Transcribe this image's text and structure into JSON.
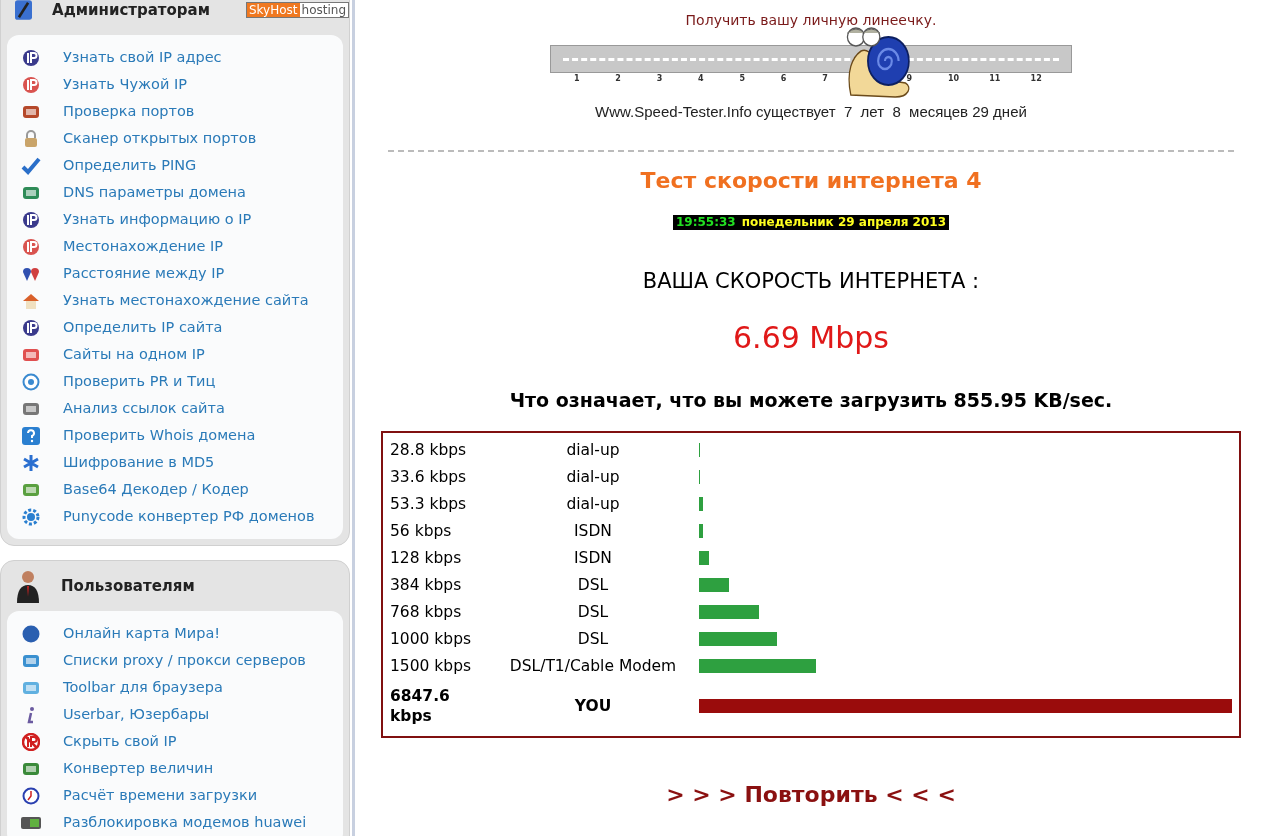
{
  "sidebar": {
    "sections": [
      {
        "title": "Администраторам",
        "badge": {
          "left": "SkyHost",
          "right": "hosting"
        },
        "items": [
          {
            "label": "Узнать свой IP адрес",
            "kind": "ip"
          },
          {
            "label": "Узнать Чужой IP",
            "kind": "ipred"
          },
          {
            "label": "Проверка портов",
            "kind": "firewall"
          },
          {
            "label": "Сканер открытых портов",
            "kind": "lock"
          },
          {
            "label": "Определить PING",
            "kind": "check"
          },
          {
            "label": "DNS параметры домена",
            "kind": "server"
          },
          {
            "label": "Узнать информацию о IP",
            "kind": "ip"
          },
          {
            "label": "Местонахождение IP",
            "kind": "ipred"
          },
          {
            "label": "Расстояние между IP",
            "kind": "pins"
          },
          {
            "label": "Узнать местонахождение сайта",
            "kind": "house"
          },
          {
            "label": "Определить IP сайта",
            "kind": "ip"
          },
          {
            "label": "Сайты на одном IP",
            "kind": "dots"
          },
          {
            "label": "Проверить PR и Тиц",
            "kind": "target"
          },
          {
            "label": "Анализ ссылок сайта",
            "kind": "network"
          },
          {
            "label": "Проверить Whois домена",
            "kind": "question"
          },
          {
            "label": "Шифрование в MD5",
            "kind": "star"
          },
          {
            "label": "Base64 Декодер / Кодер",
            "kind": "download"
          },
          {
            "label": "Punycode конвертер РФ доменов",
            "kind": "gear"
          }
        ]
      },
      {
        "title": "Пользователям",
        "items": [
          {
            "label": "Онлайн карта Мира!",
            "kind": "globe"
          },
          {
            "label": "Списки proxy / прокси серверов",
            "kind": "list"
          },
          {
            "label": "Toolbar для браузера",
            "kind": "window"
          },
          {
            "label": "Userbar, Юзербары",
            "kind": "info"
          },
          {
            "label": "Скрыть свой IP",
            "kind": "noip"
          },
          {
            "label": "Конвертер величин",
            "kind": "cubes"
          },
          {
            "label": "Расчёт времени загрузки",
            "kind": "clock"
          },
          {
            "label": "Разблокировка модемов huawei",
            "kind": "modem"
          }
        ]
      }
    ]
  },
  "ruler": {
    "link": "Получить вашу личную линеечку.",
    "ticks": [
      "1",
      "2",
      "3",
      "4",
      "5",
      "6",
      "7",
      "9",
      "10",
      "11",
      "12"
    ],
    "caption": "Www.Speed-Tester.Info существует  7  лет  8  месяцев 29 дней"
  },
  "title": "Тест скорости интернета 4",
  "clock": {
    "time": "19:55:33",
    "date": "понедельник 29 апреля 2013"
  },
  "result": {
    "label": "ВАША СКОРОСТЬ ИНТЕРНЕТА :",
    "speed": "6.69 Mbps",
    "summary": "Что означает, что вы можете загрузить 855.95 KB/sec."
  },
  "comparison": [
    {
      "speed": "28.8 kbps",
      "type": "dial-up",
      "highlight": false
    },
    {
      "speed": "33.6 kbps",
      "type": "dial-up",
      "highlight": false
    },
    {
      "speed": "53.3 kbps",
      "type": "dial-up",
      "highlight": false
    },
    {
      "speed": "56 kbps",
      "type": "ISDN",
      "highlight": false
    },
    {
      "speed": "128 kbps",
      "type": "ISDN",
      "highlight": false
    },
    {
      "speed": "384 kbps",
      "type": "DSL",
      "highlight": false
    },
    {
      "speed": "768 kbps",
      "type": "DSL",
      "highlight": false
    },
    {
      "speed": "1000 kbps",
      "type": "DSL",
      "highlight": false
    },
    {
      "speed": "1500 kbps",
      "type": "DSL/T1/Cable Modem",
      "highlight": false
    },
    {
      "speed": "6847.6 kbps",
      "type": "YOU",
      "highlight": true
    }
  ],
  "repeat": {
    "left": "> > >",
    "label": "Повторить",
    "right": "< < <"
  }
}
